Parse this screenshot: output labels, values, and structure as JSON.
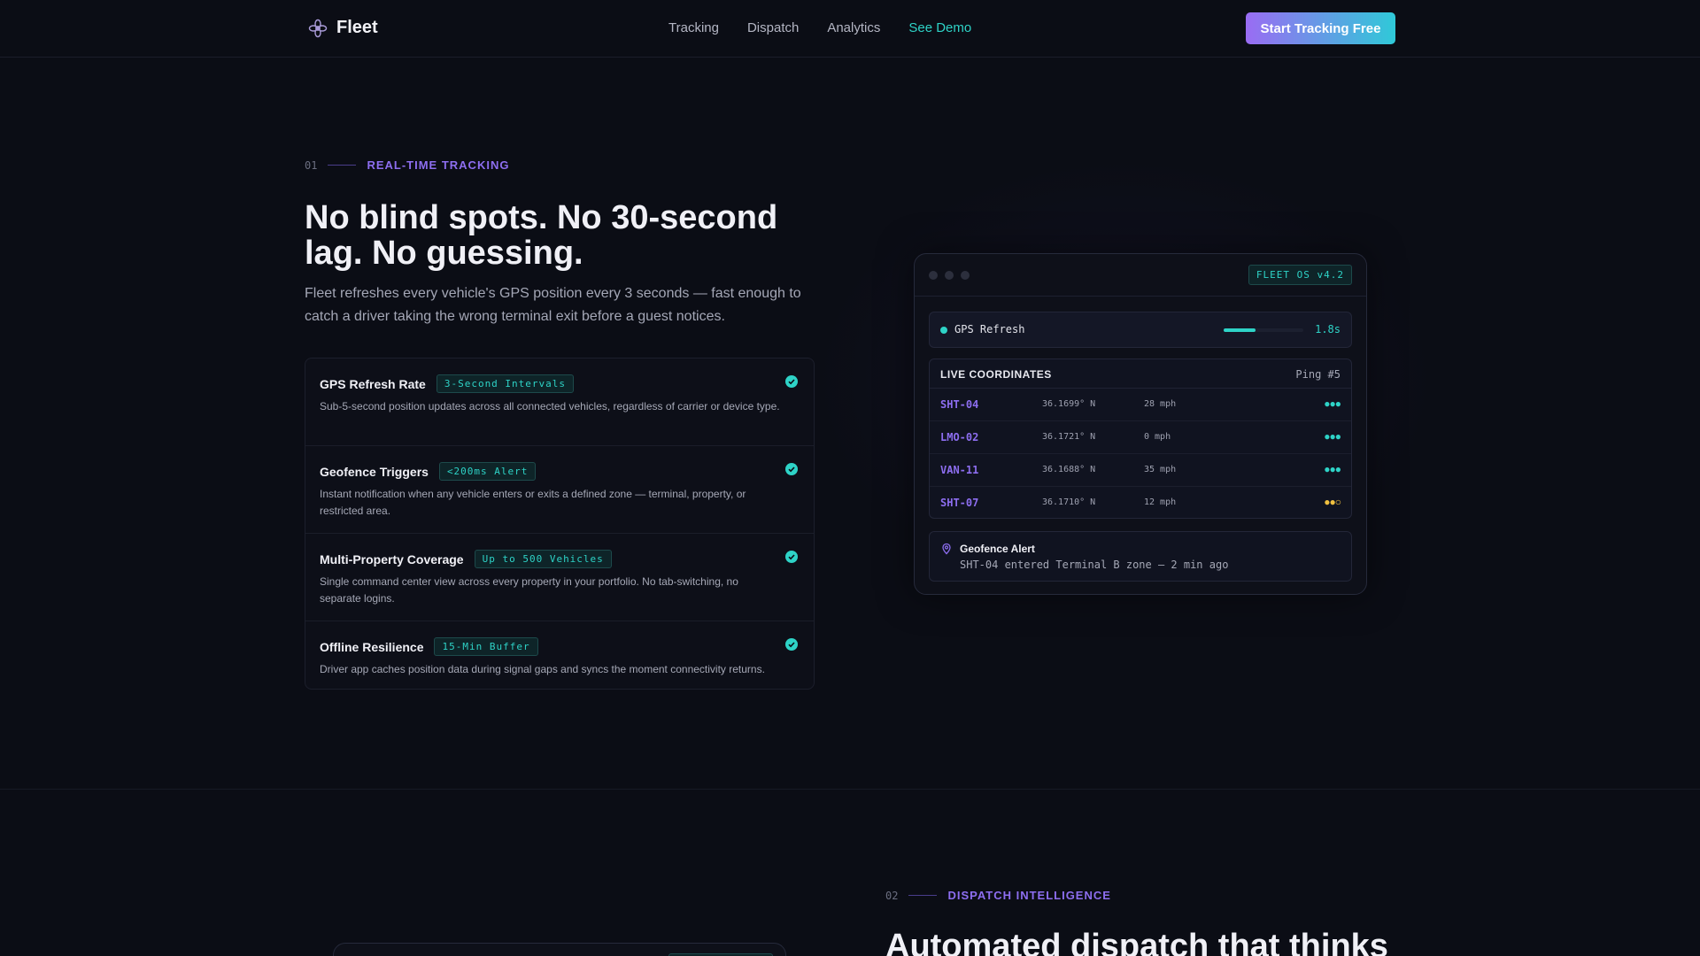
{
  "nav": {
    "brand": "Fleet",
    "links": [
      "Tracking",
      "Dispatch",
      "Analytics",
      "See Demo"
    ],
    "cta": "Start Tracking Free"
  },
  "section1": {
    "num": "01",
    "eyebrow": "REAL-TIME TRACKING",
    "title": "No blind spots. No 30-second lag. No guessing.",
    "lede": "Fleet refreshes every vehicle's GPS position every 3 seconds — fast enough to catch a driver taking the wrong terminal exit before a guest notices.",
    "features": [
      {
        "title": "GPS Refresh Rate",
        "badge": "3-Second Intervals",
        "desc": "Sub-5-second position updates across all connected vehicles, regardless of carrier or device type."
      },
      {
        "title": "Geofence Triggers",
        "badge": "<200ms Alert",
        "desc": "Instant notification when any vehicle enters or exits a defined zone — terminal, property, or restricted area."
      },
      {
        "title": "Multi-Property Coverage",
        "badge": "Up to 500 Vehicles",
        "desc": "Single command center view across every property in your portfolio. No tab-switching, no separate logins."
      },
      {
        "title": "Offline Resilience",
        "badge": "15-Min Buffer",
        "desc": "Driver app caches position data during signal gaps and syncs the moment connectivity returns."
      }
    ]
  },
  "panel": {
    "os_badge": "FLEET OS v4.2",
    "gps_label": "GPS Refresh",
    "gps_value": "1.8s",
    "gps_progress": 0.4,
    "coords_title": "LIVE COORDINATES",
    "coords_ping": "Ping #5",
    "rows": [
      {
        "id": "SHT-04",
        "lat": "36.1699° N",
        "speed": "28 mph",
        "signal": "●●●",
        "weak": false
      },
      {
        "id": "LMO-02",
        "lat": "36.1721° N",
        "speed": "0 mph",
        "signal": "●●●",
        "weak": false
      },
      {
        "id": "VAN-11",
        "lat": "36.1688° N",
        "speed": "35 mph",
        "signal": "●●●",
        "weak": false
      },
      {
        "id": "SHT-07",
        "lat": "36.1710° N",
        "speed": "12 mph",
        "signal": "●●○",
        "weak": true
      }
    ],
    "alert_title": "Geofence Alert",
    "alert_text": "SHT-04 entered Terminal B zone — 2 min ago"
  },
  "section2": {
    "num": "02",
    "eyebrow": "DISPATCH INTELLIGENCE",
    "title": "Automated dispatch that thinks"
  },
  "colors": {
    "accent_purple": "#8d6ef0",
    "accent_teal": "#2ed3c7",
    "background": "#0b0d15",
    "warning": "#f0c040"
  }
}
